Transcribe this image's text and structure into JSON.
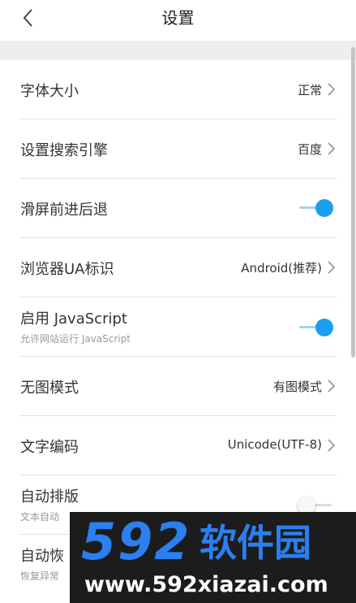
{
  "header": {
    "title": "设置",
    "back_icon": "back-arrow-icon"
  },
  "settings": {
    "font_size": {
      "label": "字体大小",
      "value": "正常"
    },
    "search_engine": {
      "label": "设置搜索引擎",
      "value": "百度"
    },
    "swipe_nav": {
      "label": "滑屏前进后退",
      "enabled": true
    },
    "user_agent": {
      "label": "浏览器UA标识",
      "value": "Android(推荐)"
    },
    "javascript": {
      "label": "启用 JavaScript",
      "sub": "允许网站运行 JavaScript",
      "enabled": true
    },
    "no_image": {
      "label": "无图模式",
      "value": "有图模式"
    },
    "encoding": {
      "label": "文字编码",
      "value": "Unicode(UTF-8)"
    },
    "auto_layout": {
      "label": "自动排版",
      "sub": "文本自动",
      "enabled": false
    },
    "auto_restore": {
      "label": "自动恢",
      "sub": "恢复异常"
    }
  },
  "watermark": {
    "logo_number": "592",
    "logo_text": "软件园",
    "url": "www.592xiazai.com"
  },
  "colors": {
    "accent": "#1a9ff0",
    "watermark_blue": "#2b7ff0",
    "watermark_bg": "#1c1c1c"
  }
}
